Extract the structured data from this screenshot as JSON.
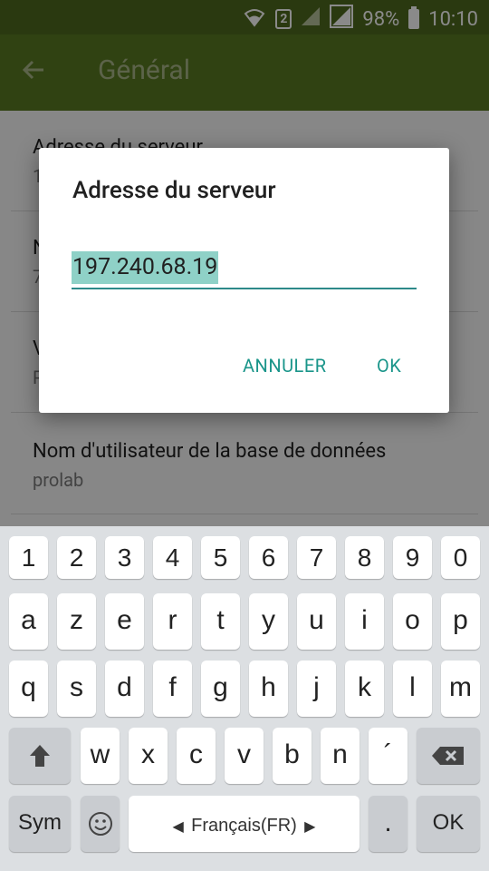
{
  "status_bar": {
    "battery": "98%",
    "time": "10:10",
    "sim": "2"
  },
  "app_bar": {
    "title": "Général"
  },
  "settings": {
    "items": [
      {
        "title": "Adresse du serveur",
        "summary": "1"
      },
      {
        "title": "N",
        "summary": "7"
      },
      {
        "title": "V",
        "summary": "P"
      },
      {
        "title": "Nom d'utilisateur de la base de données",
        "summary": "prolab"
      }
    ]
  },
  "dialog": {
    "title": "Adresse du serveur",
    "input_value": "197.240.68.19",
    "cancel_label": "ANNULER",
    "ok_label": "OK"
  },
  "keyboard": {
    "number_row": [
      "1",
      "2",
      "3",
      "4",
      "5",
      "6",
      "7",
      "8",
      "9",
      "0"
    ],
    "row1": [
      "a",
      "z",
      "e",
      "r",
      "t",
      "y",
      "u",
      "i",
      "o",
      "p"
    ],
    "row2": [
      "q",
      "s",
      "d",
      "f",
      "g",
      "h",
      "j",
      "k",
      "l",
      "m"
    ],
    "row3": [
      "w",
      "x",
      "c",
      "v",
      "b",
      "n",
      "´"
    ],
    "sym_label": "Sym",
    "language_label": "Français(FR)",
    "period_label": ".",
    "ok_label": "OK"
  }
}
